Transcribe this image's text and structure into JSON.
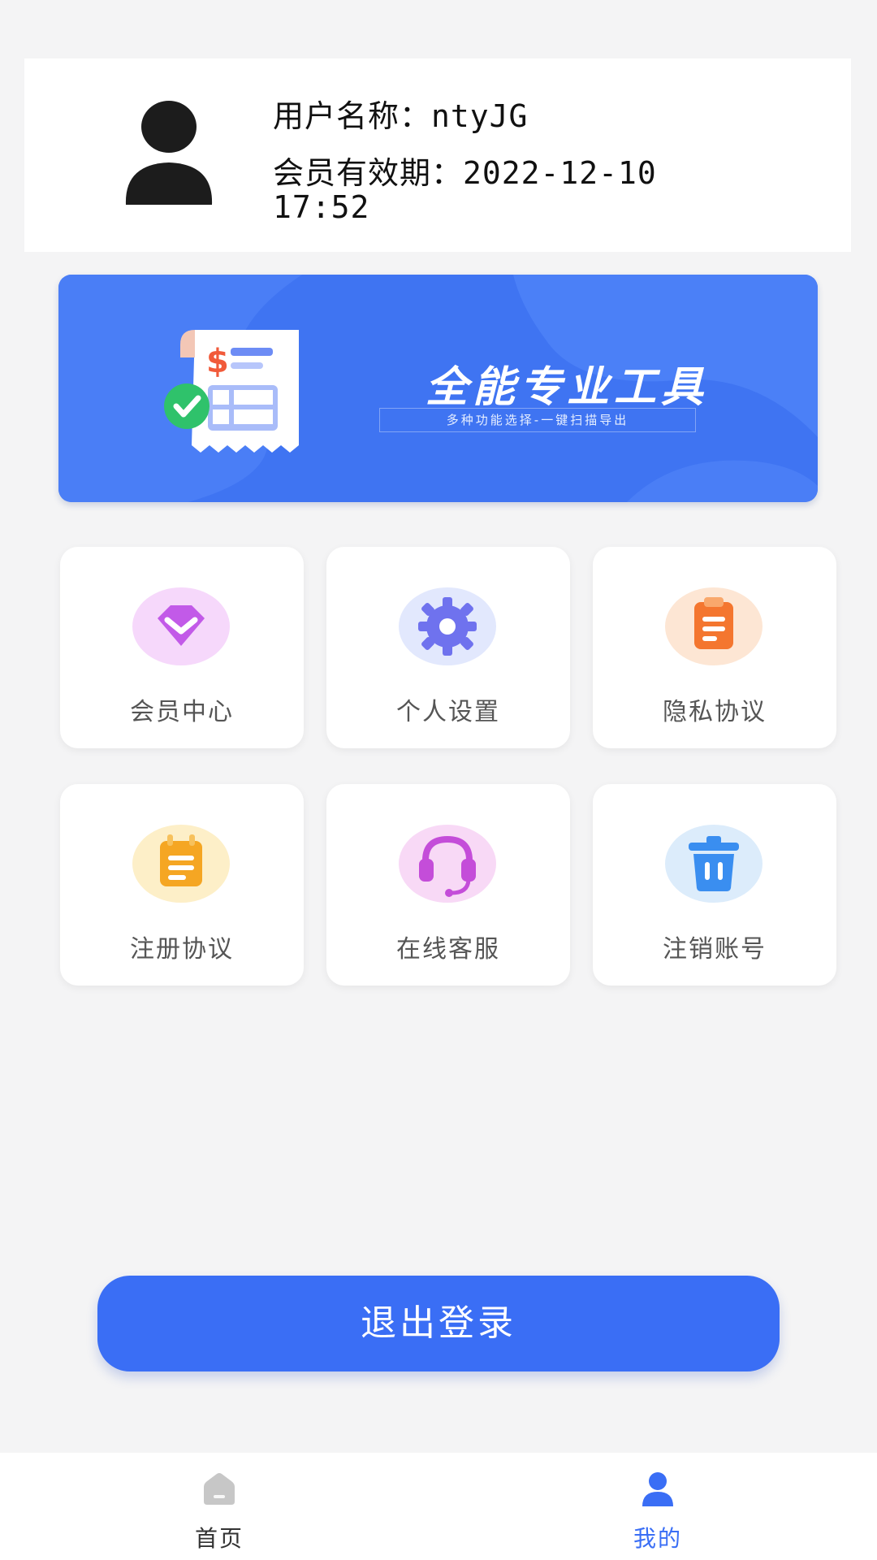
{
  "profile": {
    "username_line": "用户名称：ntyJG",
    "expiry_label": "会员有效期：",
    "expiry_date": "2022-12-10",
    "expiry_time": "17:52"
  },
  "banner": {
    "title": "全能专业工具",
    "subtitle": "多种功能选择-一键扫描导出",
    "colors": {
      "background": "#3f74f2"
    }
  },
  "menu": {
    "items": [
      {
        "label": "会员中心",
        "icon": "diamond-icon"
      },
      {
        "label": "个人设置",
        "icon": "gear-icon"
      },
      {
        "label": "隐私协议",
        "icon": "clipboard-icon"
      },
      {
        "label": "注册协议",
        "icon": "notepad-icon"
      },
      {
        "label": "在线客服",
        "icon": "headset-icon"
      },
      {
        "label": "注销账号",
        "icon": "trash-icon"
      }
    ]
  },
  "logout": {
    "label": "退出登录",
    "color": "#3a6ef5"
  },
  "tabbar": {
    "tabs": [
      {
        "label": "首页",
        "icon": "home-icon",
        "active": false
      },
      {
        "label": "我的",
        "icon": "person-icon",
        "active": true
      }
    ],
    "active_color": "#3a6ef5",
    "inactive_color": "#333333"
  }
}
